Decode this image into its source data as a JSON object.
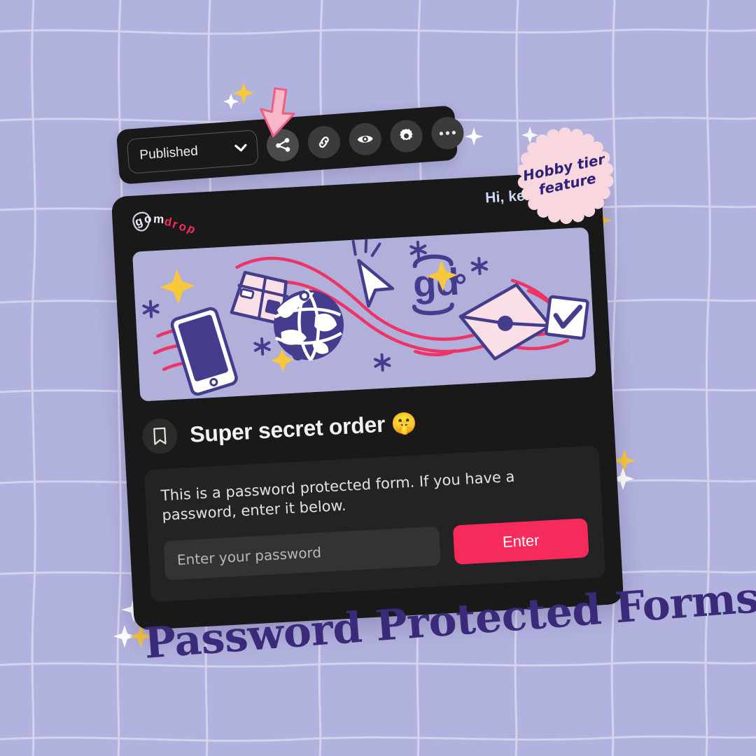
{
  "theme": {
    "background": "#b2b2de",
    "grid_line": "#d8d8ef",
    "card_dark": "#191919",
    "panel_dark": "#232323",
    "input_dark": "#333333",
    "accent_pink": "#f72a5c",
    "deep_purple": "#3b2a7a",
    "badge_pink": "#f9d7df",
    "illustration_bg": "#b0b0da",
    "sparkle_gold": "#f7c73c",
    "sparkle_white": "#ffffff",
    "arrow_pink": "#f7b9c8"
  },
  "toolbar": {
    "status_value": "Published",
    "chevron": "⌄",
    "buttons": [
      {
        "name": "share-button",
        "icon": "share-icon"
      },
      {
        "name": "link-button",
        "icon": "link-icon"
      },
      {
        "name": "preview-button",
        "icon": "eye-icon"
      },
      {
        "name": "settings-button",
        "icon": "gear-icon"
      },
      {
        "name": "more-button",
        "icon": "ellipsis-icon"
      }
    ]
  },
  "badge": {
    "line1": "Hobby tier",
    "line2": "feature"
  },
  "app": {
    "logo": {
      "part1": "gom",
      "part2": "drop",
      "letters_light": [
        "g",
        "o",
        "m"
      ],
      "letters_pink": [
        "d",
        "r",
        "o",
        "p"
      ]
    },
    "greeting": "Hi, kenia!",
    "bookmark_icon": "bookmark-icon"
  },
  "form": {
    "title": "Super secret order",
    "title_emoji": "🤫",
    "description": "This is a password protected form. If you have a password, enter it below.",
    "password_placeholder": "Enter your password",
    "password_value": "",
    "submit_label": "Enter"
  },
  "headline": "Password Protected Forms",
  "illustration": {
    "items": [
      "phone-icon",
      "package-box-icon",
      "globe-icon",
      "cursor-arrow-icon",
      "gd-logo-icon",
      "envelope-icon",
      "checkbox-checked-icon",
      "sparkle-icon",
      "asterisk-icon",
      "swoosh-line"
    ]
  }
}
